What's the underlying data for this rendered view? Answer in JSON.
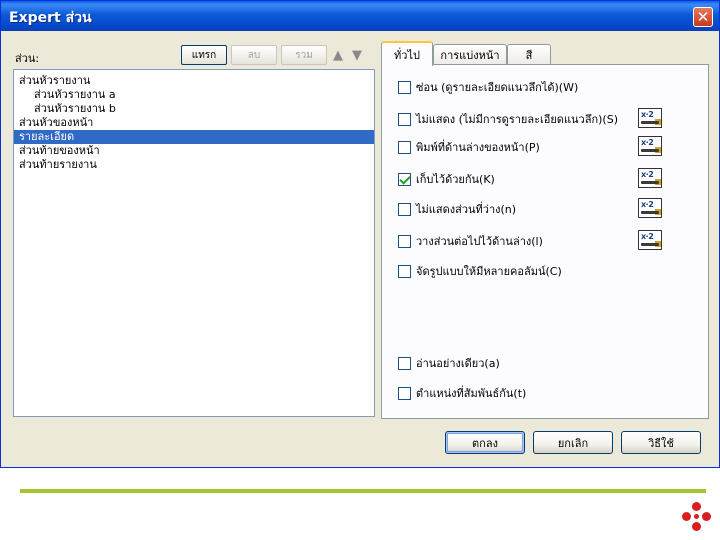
{
  "window": {
    "title": "Expert ส่วน",
    "close_glyph": "✕"
  },
  "left": {
    "label": "ส่วน:",
    "toolbar": {
      "insert_label": "แทรก",
      "delete_label": "ลบ",
      "merge_label": "รวม"
    },
    "tree": [
      {
        "label": "ส่วนหัวรายงาน",
        "level": 0,
        "selected": false
      },
      {
        "label": "ส่วนหัวรายงาน a",
        "level": 1,
        "selected": false
      },
      {
        "label": "ส่วนหัวรายงาน b",
        "level": 1,
        "selected": false
      },
      {
        "label": "ส่วนหัวของหน้า",
        "level": 0,
        "selected": false
      },
      {
        "label": "รายละเอียด",
        "level": 0,
        "selected": true
      },
      {
        "label": "ส่วนท้ายของหน้า",
        "level": 0,
        "selected": false
      },
      {
        "label": "ส่วนท้ายรายงาน",
        "level": 0,
        "selected": false
      }
    ]
  },
  "tabs": {
    "general": "ทั่วไป",
    "paging": "การแบ่งหน้า",
    "color": "สี"
  },
  "options": [
    {
      "label": "ซ่อน (ดูรายละเอียดแนวลึกได้)(W)",
      "checked": false,
      "has_formula": false
    },
    {
      "label": "ไม่แสดง (ไม่มีการดูรายละเอียดแนวลึก)(S)",
      "checked": false,
      "has_formula": true
    },
    {
      "label": "พิมพ์ที่ด้านล่างของหน้า(P)",
      "checked": false,
      "has_formula": true
    },
    {
      "label": "เก็บไว้ด้วยกัน(K)",
      "checked": true,
      "has_formula": true
    },
    {
      "label": "ไม่แสดงส่วนที่ว่าง(n)",
      "checked": false,
      "has_formula": true
    },
    {
      "label": "วางส่วนต่อไปไว้ด้านล่าง(l)",
      "checked": false,
      "has_formula": true
    },
    {
      "label": "จัดรูปแบบให้มีหลายคอลัมน์(C)",
      "checked": false,
      "has_formula": false
    },
    {
      "label": "อ่านอย่างเดียว(a)",
      "checked": false,
      "has_formula": false
    },
    {
      "label": "ตำแหน่งที่สัมพันธ์กัน(t)",
      "checked": false,
      "has_formula": false
    }
  ],
  "buttons": {
    "ok": "ตกลง",
    "cancel": "ยกเลิก",
    "help": "วิธีใช้"
  },
  "colors": {
    "titlebar": "#0a5fe8",
    "selection": "#316ac5",
    "accent_line": "#a3c62c",
    "logo": "#d81e1e"
  }
}
